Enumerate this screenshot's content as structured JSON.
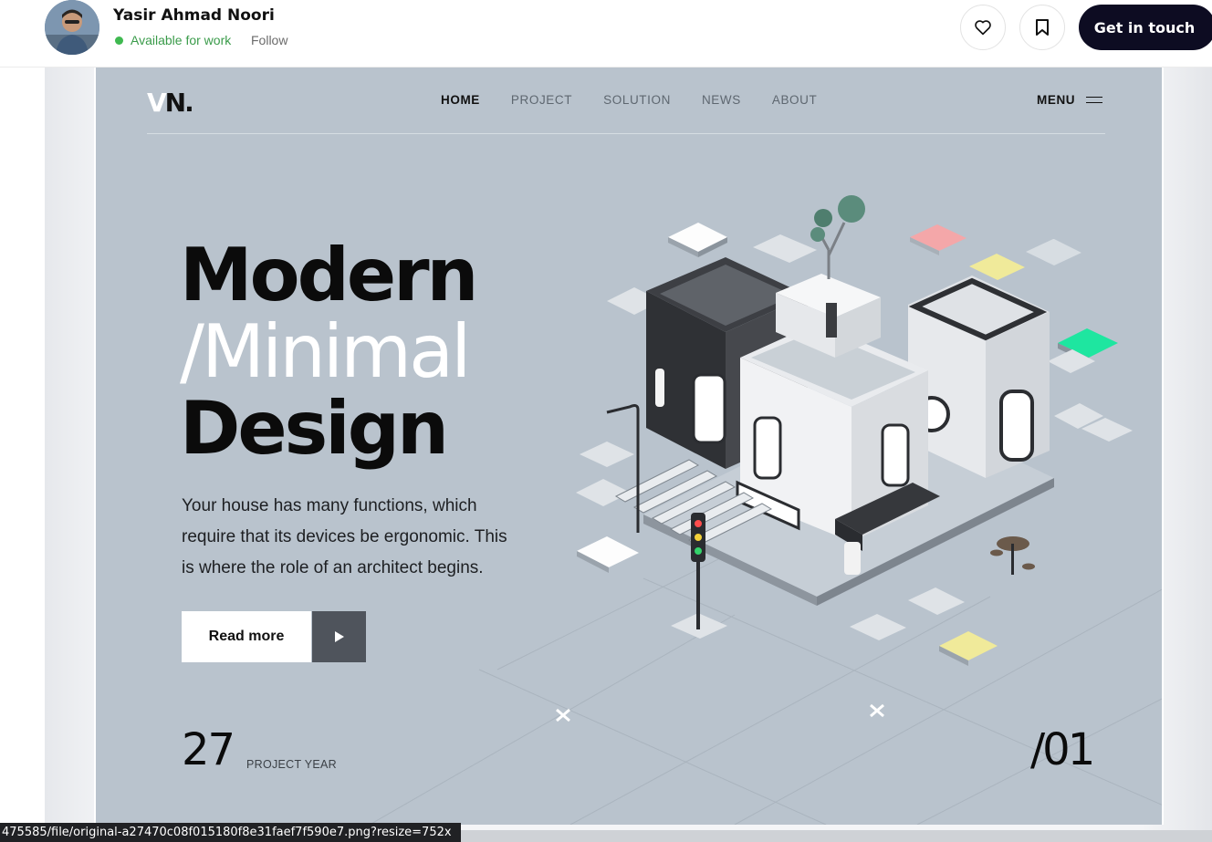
{
  "profile": {
    "name": "Yasir Ahmad Noori",
    "availability": "Available for work",
    "follow_label": "Follow",
    "cta_label": "Get in touch",
    "like_icon": "heart-icon",
    "save_icon": "bookmark-icon"
  },
  "shot": {
    "logo_v": "V",
    "logo_rest": "N.",
    "nav": [
      "HOME",
      "PROJECT",
      "SOLUTION",
      "NEWS",
      "ABOUT"
    ],
    "nav_active": "HOME",
    "menu_label": "MENU",
    "headline": {
      "line1": "Modern",
      "line2": "/Minimal",
      "line3": "Design"
    },
    "description": "Your house has many functions, which require that its devices be ergonomic. This is where the role of an architect begins.",
    "read_more_label": "Read more",
    "year_value": "27",
    "year_label": "PROJECT YEAR",
    "slide_index": "/01",
    "colors": {
      "background": "#b9c3cd",
      "tile_pink": "#f4a7a9",
      "tile_yellow": "#f0ea9a",
      "tile_green": "#1ee6a0",
      "cta": "#0d0c22"
    }
  },
  "status_url": "475585/file/original-a27470c08f015180f8e31faef7f590e7.png?resize=752x"
}
